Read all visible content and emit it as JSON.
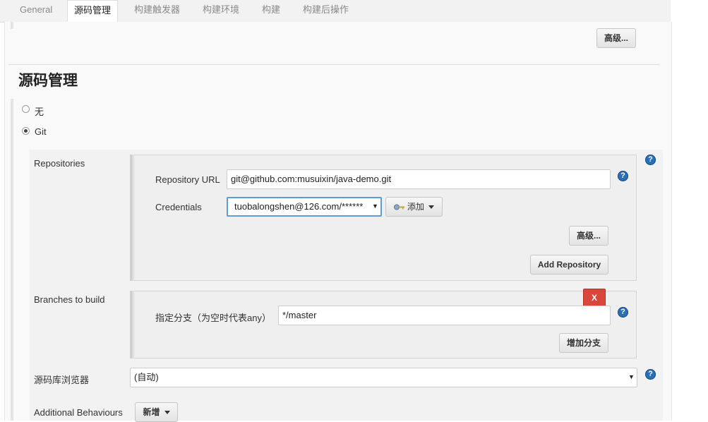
{
  "tabs": [
    {
      "label": "General"
    },
    {
      "label": "源码管理"
    },
    {
      "label": "构建触发器"
    },
    {
      "label": "构建环境"
    },
    {
      "label": "构建"
    },
    {
      "label": "构建后操作"
    }
  ],
  "top_advanced_label": "高级...",
  "section_title": "源码管理",
  "scm_options": [
    {
      "label": "无",
      "selected": false
    },
    {
      "label": "Git",
      "selected": true
    }
  ],
  "repositories": {
    "label": "Repositories",
    "url_label": "Repository URL",
    "url_value": "git@github.com:musuixin/java-demo.git",
    "credentials_label": "Credentials",
    "credentials_value": "tuobalongshen@126.com/******",
    "add_label": "添加",
    "advanced_label": "高级...",
    "add_repository_label": "Add Repository"
  },
  "branches": {
    "label": "Branches to build",
    "delete_label": "X",
    "specifier_label": "指定分支（为空时代表any）",
    "specifier_value": "*/master",
    "add_branch_label": "增加分支"
  },
  "browser": {
    "label": "源码库浏览器",
    "value": "(自动)"
  },
  "behaviours": {
    "label": "Additional Behaviours",
    "add_label": "新增"
  },
  "help_glyph": "?",
  "colors": {
    "help_blue": "#2a6fb5",
    "delete_red": "#d9463a",
    "focus_blue": "#5b9dd9"
  }
}
